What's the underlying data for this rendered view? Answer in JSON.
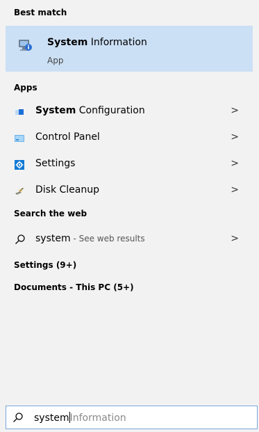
{
  "best_match": {
    "header": "Best match",
    "title_bold": "System",
    "title_rest": " Information",
    "subtitle": "App",
    "icon": "system-information-icon"
  },
  "apps": {
    "header": "Apps",
    "items": [
      {
        "bold": "System",
        "rest": " Configuration",
        "icon": "system-configuration-icon"
      },
      {
        "bold": "",
        "rest": "Control Panel",
        "icon": "control-panel-icon"
      },
      {
        "bold": "",
        "rest": "Settings",
        "icon": "settings-gear-icon"
      },
      {
        "bold": "",
        "rest": "Disk Cleanup",
        "icon": "disk-cleanup-icon"
      }
    ]
  },
  "web": {
    "header": "Search the web",
    "query": "system",
    "suffix": " - See web results"
  },
  "more": {
    "settings": "Settings (9+)",
    "documents": "Documents - This PC (5+)"
  },
  "search": {
    "typed": "system",
    "suggestion": "Information"
  },
  "colors": {
    "selected": "#cce0f5",
    "accent": "#0078d7",
    "panel": "#f2f2f2"
  }
}
